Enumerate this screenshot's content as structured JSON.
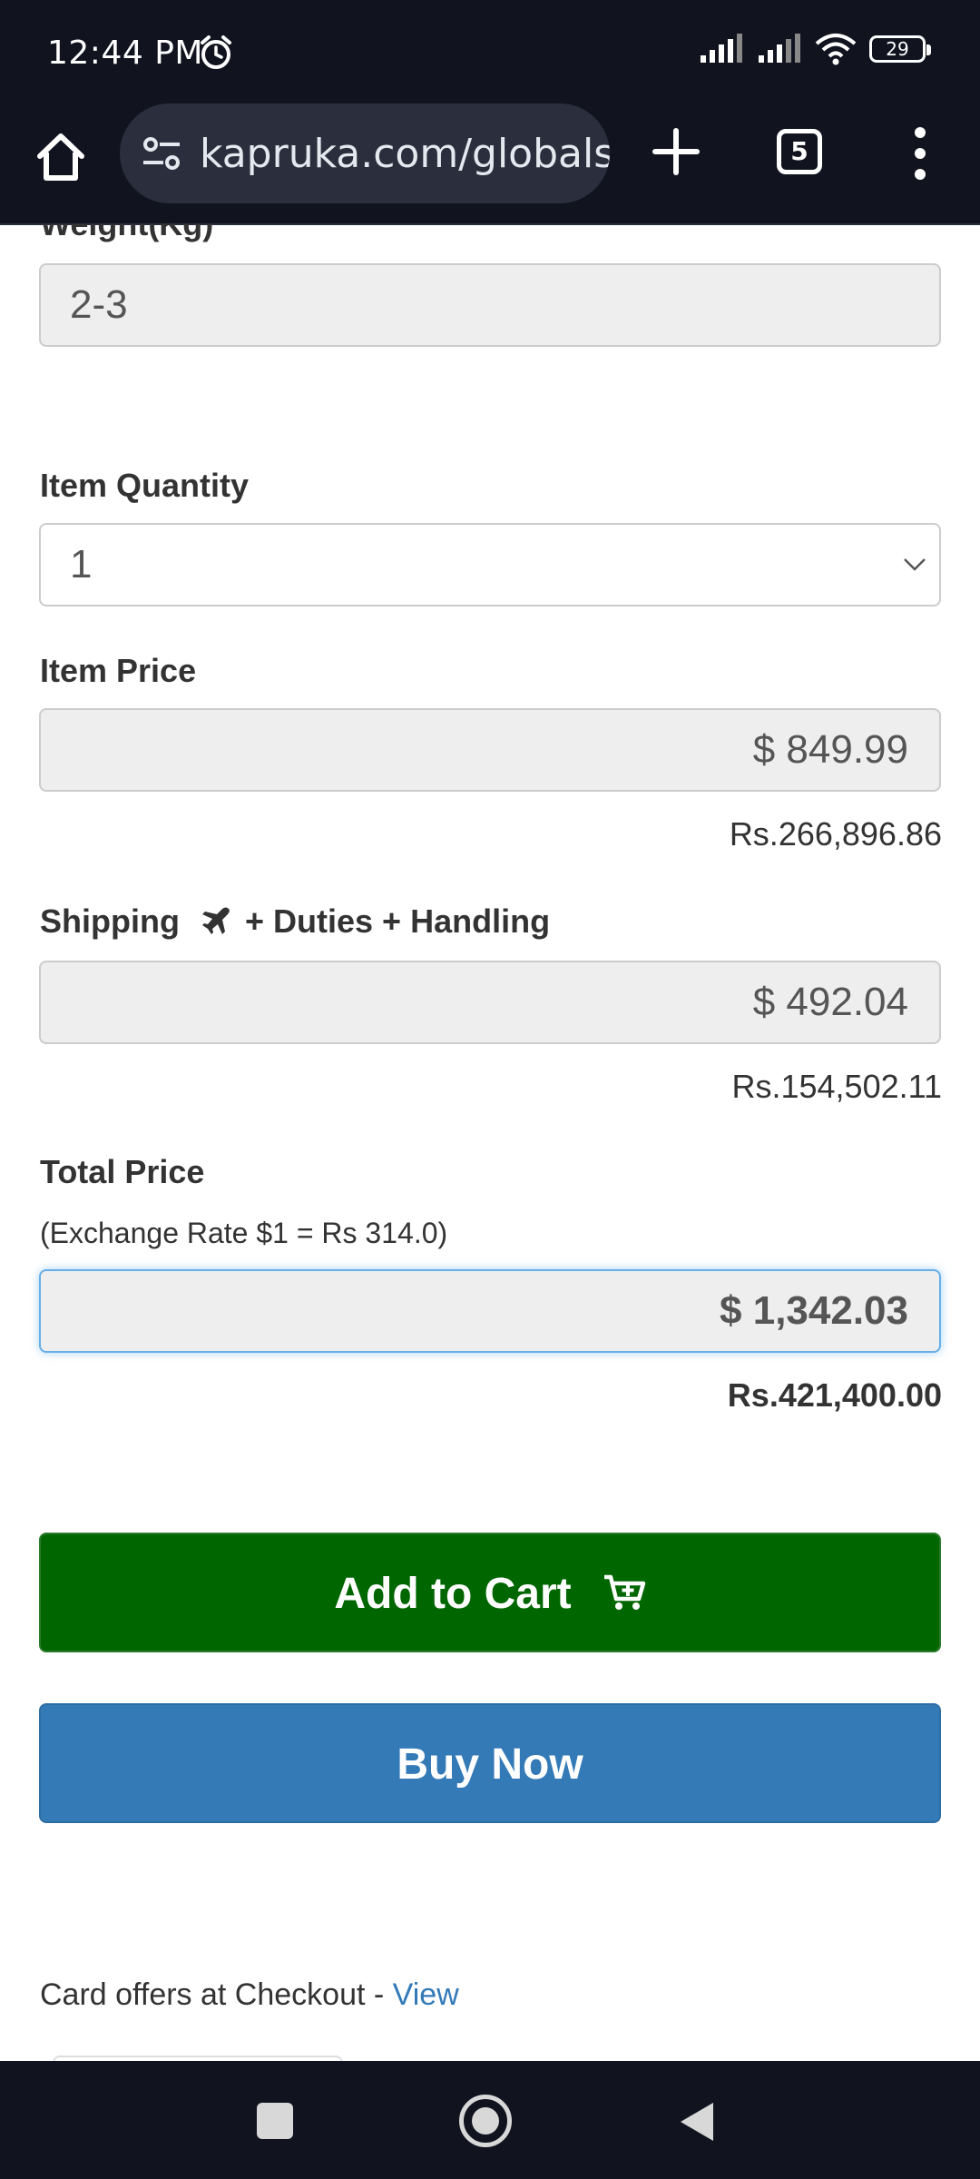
{
  "status_bar": {
    "time": "12:44 PM",
    "battery": "29",
    "icons": [
      "alarm-icon",
      "signal-icon",
      "signal-icon",
      "wifi-icon",
      "battery-icon"
    ]
  },
  "browser": {
    "url": "kapruka.com/globalshop",
    "tab_count": "5",
    "icons": [
      "home-icon",
      "site-settings-icon",
      "plus-icon",
      "tabs-icon",
      "more-vert-icon"
    ]
  },
  "form": {
    "weight": {
      "label": "Weight(Kg)",
      "value": "2-3"
    },
    "quantity": {
      "label": "Item Quantity",
      "value": "1"
    },
    "item_price": {
      "label": "Item Price",
      "usd": "$ 849.99",
      "rs": "Rs.266,896.86"
    },
    "shipping": {
      "label_a": "Shipping",
      "label_b": "+ Duties + Handling",
      "usd": "$ 492.04",
      "rs": "Rs.154,502.11"
    },
    "total": {
      "label": "Total Price",
      "exchange_note": "(Exchange Rate $1 = Rs 314.0)",
      "usd": "$ 1,342.03",
      "rs": "Rs.421,400.00"
    }
  },
  "actions": {
    "add_to_cart": "Add to Cart",
    "buy_now": "Buy Now"
  },
  "offers": {
    "text": "Card offers at Checkout - ",
    "link": "View"
  },
  "colors": {
    "cart_green": "#006600",
    "buy_blue": "#337ab7",
    "link_blue": "#337ab7",
    "system_bar": "#11141f"
  }
}
